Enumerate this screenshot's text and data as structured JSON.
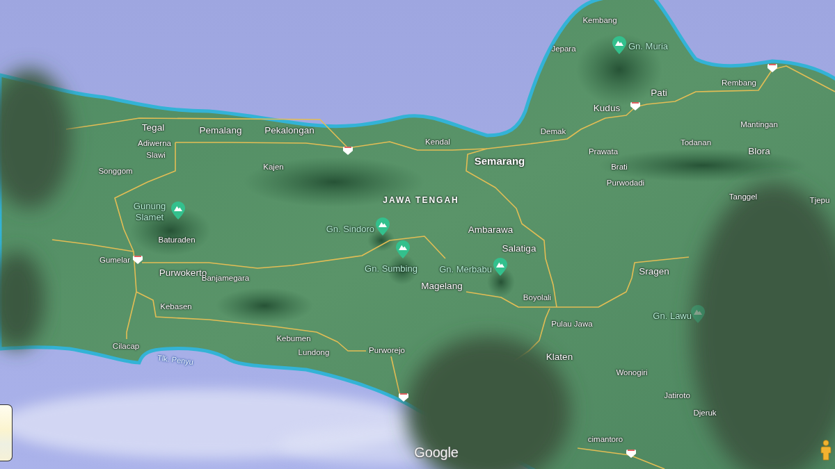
{
  "map": {
    "region_label": "JAWA TENGAH",
    "places": [
      {
        "name": "Kembang",
        "kind": "town"
      },
      {
        "name": "Jepara",
        "kind": "town"
      },
      {
        "name": "Rembang",
        "kind": "town"
      },
      {
        "name": "Pati",
        "kind": "city"
      },
      {
        "name": "Kudus",
        "kind": "city"
      },
      {
        "name": "Tegal",
        "kind": "city"
      },
      {
        "name": "Pemalang",
        "kind": "city"
      },
      {
        "name": "Pekalongan",
        "kind": "city"
      },
      {
        "name": "Demak",
        "kind": "town"
      },
      {
        "name": "Mantingan",
        "kind": "town"
      },
      {
        "name": "Adiwerna",
        "kind": "town"
      },
      {
        "name": "Kendal",
        "kind": "town"
      },
      {
        "name": "Todanan",
        "kind": "town"
      },
      {
        "name": "Slawi",
        "kind": "town"
      },
      {
        "name": "Prawata",
        "kind": "town"
      },
      {
        "name": "Blora",
        "kind": "city"
      },
      {
        "name": "Songgom",
        "kind": "town"
      },
      {
        "name": "Kajen",
        "kind": "town"
      },
      {
        "name": "Semarang",
        "kind": "major"
      },
      {
        "name": "Brati",
        "kind": "town"
      },
      {
        "name": "Purwodadi",
        "kind": "town"
      },
      {
        "name": "Tanggel",
        "kind": "town"
      },
      {
        "name": "Tjepu",
        "kind": "town"
      },
      {
        "name": "Ambarawa",
        "kind": "city"
      },
      {
        "name": "Baturaden",
        "kind": "town"
      },
      {
        "name": "Salatiga",
        "kind": "city"
      },
      {
        "name": "Gumelar",
        "kind": "town"
      },
      {
        "name": "Purwokerto",
        "kind": "city"
      },
      {
        "name": "Banjamegara",
        "kind": "town"
      },
      {
        "name": "Sragen",
        "kind": "city"
      },
      {
        "name": "Magelang",
        "kind": "city"
      },
      {
        "name": "Boyolali",
        "kind": "town"
      },
      {
        "name": "Kebasen",
        "kind": "town"
      },
      {
        "name": "Pulau Jawa",
        "kind": "town"
      },
      {
        "name": "Cilacap",
        "kind": "town"
      },
      {
        "name": "Kebumen",
        "kind": "town"
      },
      {
        "name": "Lundong",
        "kind": "town"
      },
      {
        "name": "Purworejo",
        "kind": "town"
      },
      {
        "name": "Klaten",
        "kind": "city"
      },
      {
        "name": "Wonogiri",
        "kind": "town"
      },
      {
        "name": "Jatiroto",
        "kind": "town"
      },
      {
        "name": "Djeruk",
        "kind": "town"
      },
      {
        "name": "cimantoro",
        "kind": "town"
      }
    ],
    "peaks": [
      {
        "name": "Gn. Muria"
      },
      {
        "name": "Gunung Slamet"
      },
      {
        "name": "Gn. Sindoro"
      },
      {
        "name": "Gn. Sumbing"
      },
      {
        "name": "Gn. Merbabu"
      },
      {
        "name": "Gn. Lawu"
      }
    ],
    "water_labels": [
      {
        "name": "Tlk. Penyu"
      }
    ]
  },
  "logo": "Google"
}
